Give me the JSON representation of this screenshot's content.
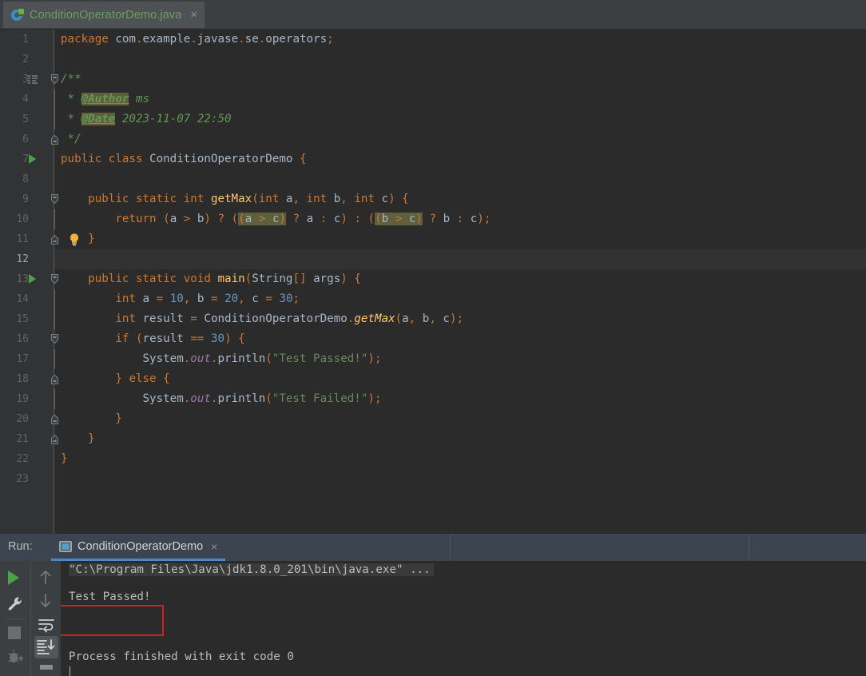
{
  "window": {
    "title": "ConditionOperatorDemo.java",
    "theme": "darcula"
  },
  "editor_tab": {
    "label": "ConditionOperatorDemo.java",
    "icon": "java-class-icon",
    "close": "×",
    "text_color": "#6a9e5f"
  },
  "code": {
    "language": "java",
    "line_count": 23,
    "caret_line": 12,
    "lines": [
      {
        "n": 1,
        "text": "package com.example.javase.se.operators;"
      },
      {
        "n": 2,
        "text": ""
      },
      {
        "n": 3,
        "text": "/**"
      },
      {
        "n": 4,
        "text": " * @Author ms"
      },
      {
        "n": 5,
        "text": " * @Date 2023-11-07 22:50"
      },
      {
        "n": 6,
        "text": " */"
      },
      {
        "n": 7,
        "text": "public class ConditionOperatorDemo {"
      },
      {
        "n": 8,
        "text": ""
      },
      {
        "n": 9,
        "text": "    public static int getMax(int a, int b, int c) {"
      },
      {
        "n": 10,
        "text": "        return (a > b) ? ((a > c) ? a : c) : ((b > c) ? b : c);"
      },
      {
        "n": 11,
        "text": "    }"
      },
      {
        "n": 12,
        "text": ""
      },
      {
        "n": 13,
        "text": "    public static void main(String[] args) {"
      },
      {
        "n": 14,
        "text": "        int a = 10, b = 20, c = 30;"
      },
      {
        "n": 15,
        "text": "        int result = ConditionOperatorDemo.getMax(a, b, c);"
      },
      {
        "n": 16,
        "text": "        if (result == 30) {"
      },
      {
        "n": 17,
        "text": "            System.out.println(\"Test Passed!\");"
      },
      {
        "n": 18,
        "text": "        } else {"
      },
      {
        "n": 19,
        "text": "            System.out.println(\"Test Failed!\");"
      },
      {
        "n": 20,
        "text": "        }"
      },
      {
        "n": 21,
        "text": "    }"
      },
      {
        "n": 22,
        "text": "}"
      },
      {
        "n": 23,
        "text": ""
      }
    ],
    "javadoc_tags": [
      "@Author",
      "@Date"
    ],
    "javadoc_values": {
      "author": "ms",
      "date": "2023-11-07 22:50"
    },
    "gutter_icons": [
      {
        "line": 3,
        "icon": "javadoc-icon"
      },
      {
        "line": 3,
        "icon": "fold-collapse-icon"
      },
      {
        "line": 6,
        "icon": "fold-end-icon"
      },
      {
        "line": 7,
        "icon": "run-class-icon"
      },
      {
        "line": 9,
        "icon": "fold-collapse-icon"
      },
      {
        "line": 11,
        "icon": "intention-bulb-icon"
      },
      {
        "line": 11,
        "icon": "fold-end-icon"
      },
      {
        "line": 13,
        "icon": "run-method-icon"
      },
      {
        "line": 13,
        "icon": "fold-collapse-icon"
      },
      {
        "line": 16,
        "icon": "fold-collapse-icon"
      },
      {
        "line": 18,
        "icon": "fold-end-icon"
      },
      {
        "line": 20,
        "icon": "fold-end-icon"
      },
      {
        "line": 21,
        "icon": "fold-end-icon"
      }
    ],
    "syntax_colors": {
      "keyword": "#cc7832",
      "number": "#6897bb",
      "string": "#6a8759",
      "comment": "#629755",
      "method": "#ffc66d",
      "field": "#9876aa",
      "identifier": "#a9b7c6",
      "highlight_bg": "#5f5e3d",
      "editor_bg": "#2b2b2b",
      "gutter_bg": "#313335"
    }
  },
  "run_panel": {
    "label": "Run:",
    "tab": {
      "label": "ConditionOperatorDemo",
      "icon": "run-configuration-icon",
      "close": "×",
      "active_underline_color": "#4a88c7"
    },
    "toolbar_left": [
      {
        "name": "rerun-button",
        "icon": "green-play-icon",
        "enabled": true
      },
      {
        "name": "settings-button",
        "icon": "wrench-icon",
        "enabled": true
      },
      {
        "name": "stop-button",
        "icon": "stop-square-icon",
        "enabled": false
      },
      {
        "name": "debug-button",
        "icon": "bug-rerun-icon",
        "enabled": false
      }
    ],
    "toolbar_right": [
      {
        "name": "up-button",
        "icon": "arrow-up-icon",
        "enabled": false
      },
      {
        "name": "down-button",
        "icon": "arrow-down-icon",
        "enabled": false
      },
      {
        "name": "soft-wrap-button",
        "icon": "soft-wrap-icon",
        "enabled": true
      },
      {
        "name": "scroll-to-end-button",
        "icon": "scroll-to-end-icon",
        "enabled": true,
        "selected": true
      },
      {
        "name": "print-button",
        "icon": "print-icon",
        "enabled": true
      }
    ],
    "console": {
      "command_line": "\"C:\\Program Files\\Java\\jdk1.8.0_201\\bin\\java.exe\" ...",
      "output_line": "Test Passed!",
      "exit_line": "Process finished with exit code 0",
      "text_color": "#bbbbbb"
    },
    "annotation": {
      "type": "red-rectangle-highlight",
      "target": "Test Passed!",
      "color": "#cc2222"
    }
  }
}
